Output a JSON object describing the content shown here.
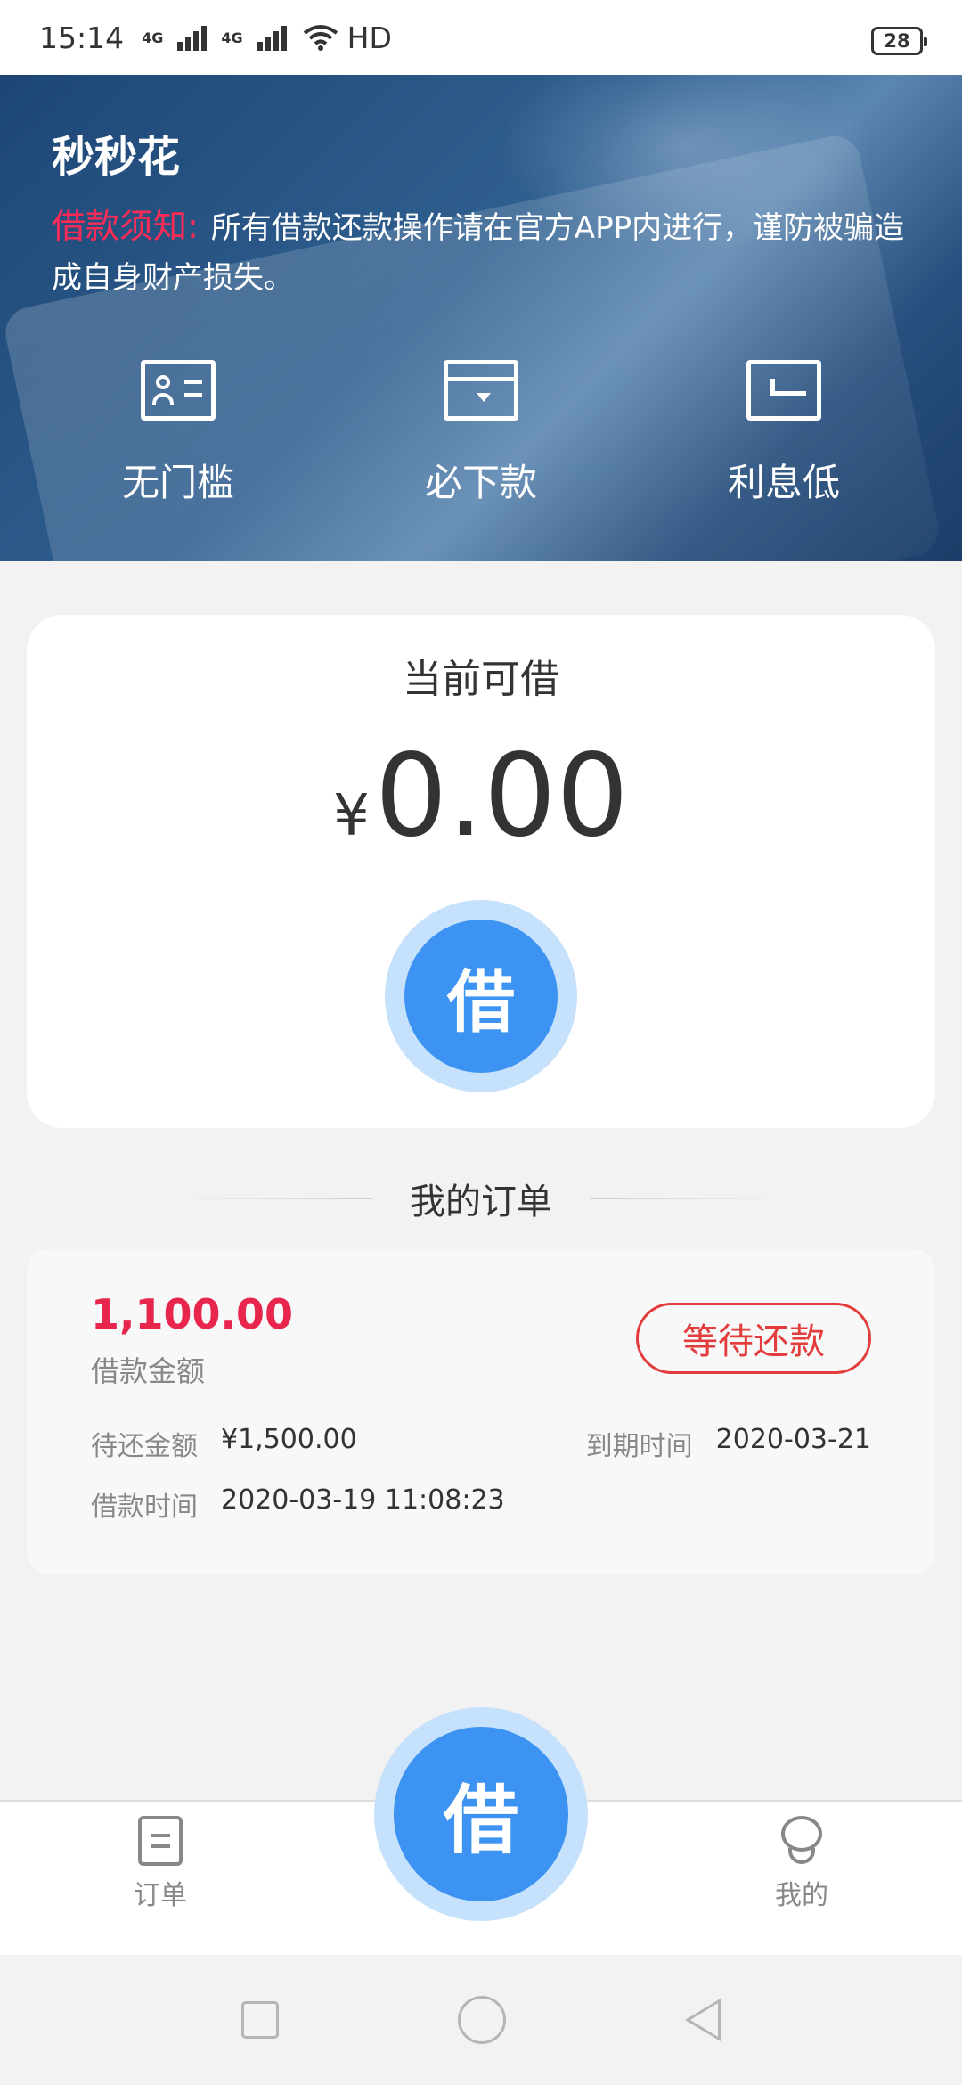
{
  "status_bar": {
    "time": "15:14",
    "network1": "4G",
    "network2": "4G",
    "hd": "HD",
    "battery": "28"
  },
  "banner": {
    "app_title": "秒秒花",
    "notice_label": "借款须知:",
    "notice_text": "所有借款还款操作请在官方APP内进行，谨防被骗造成自身财产损失。",
    "features": [
      {
        "icon": "id-card-icon",
        "label": "无门槛"
      },
      {
        "icon": "wallet-icon",
        "label": "必下款"
      },
      {
        "icon": "low-arrow-icon",
        "label": "利息低"
      }
    ]
  },
  "available": {
    "title": "当前可借",
    "currency": "¥",
    "amount": "0.00",
    "borrow_label": "借"
  },
  "orders": {
    "title": "我的订单",
    "items": [
      {
        "amount": "1,100.00",
        "amount_label": "借款金额",
        "status": "等待还款",
        "pending_label": "待还金额",
        "pending_value": "¥1,500.00",
        "due_label": "到期时间",
        "due_value": "2020-03-21",
        "time_label": "借款时间",
        "time_value": "2020-03-19 11:08:23"
      }
    ]
  },
  "bottom_nav": {
    "orders_label": "订单",
    "center_label": "借",
    "mine_label": "我的"
  },
  "colors": {
    "accent_blue": "#3c93f2",
    "accent_red": "#e8264d",
    "status_red": "#e23c3c"
  }
}
